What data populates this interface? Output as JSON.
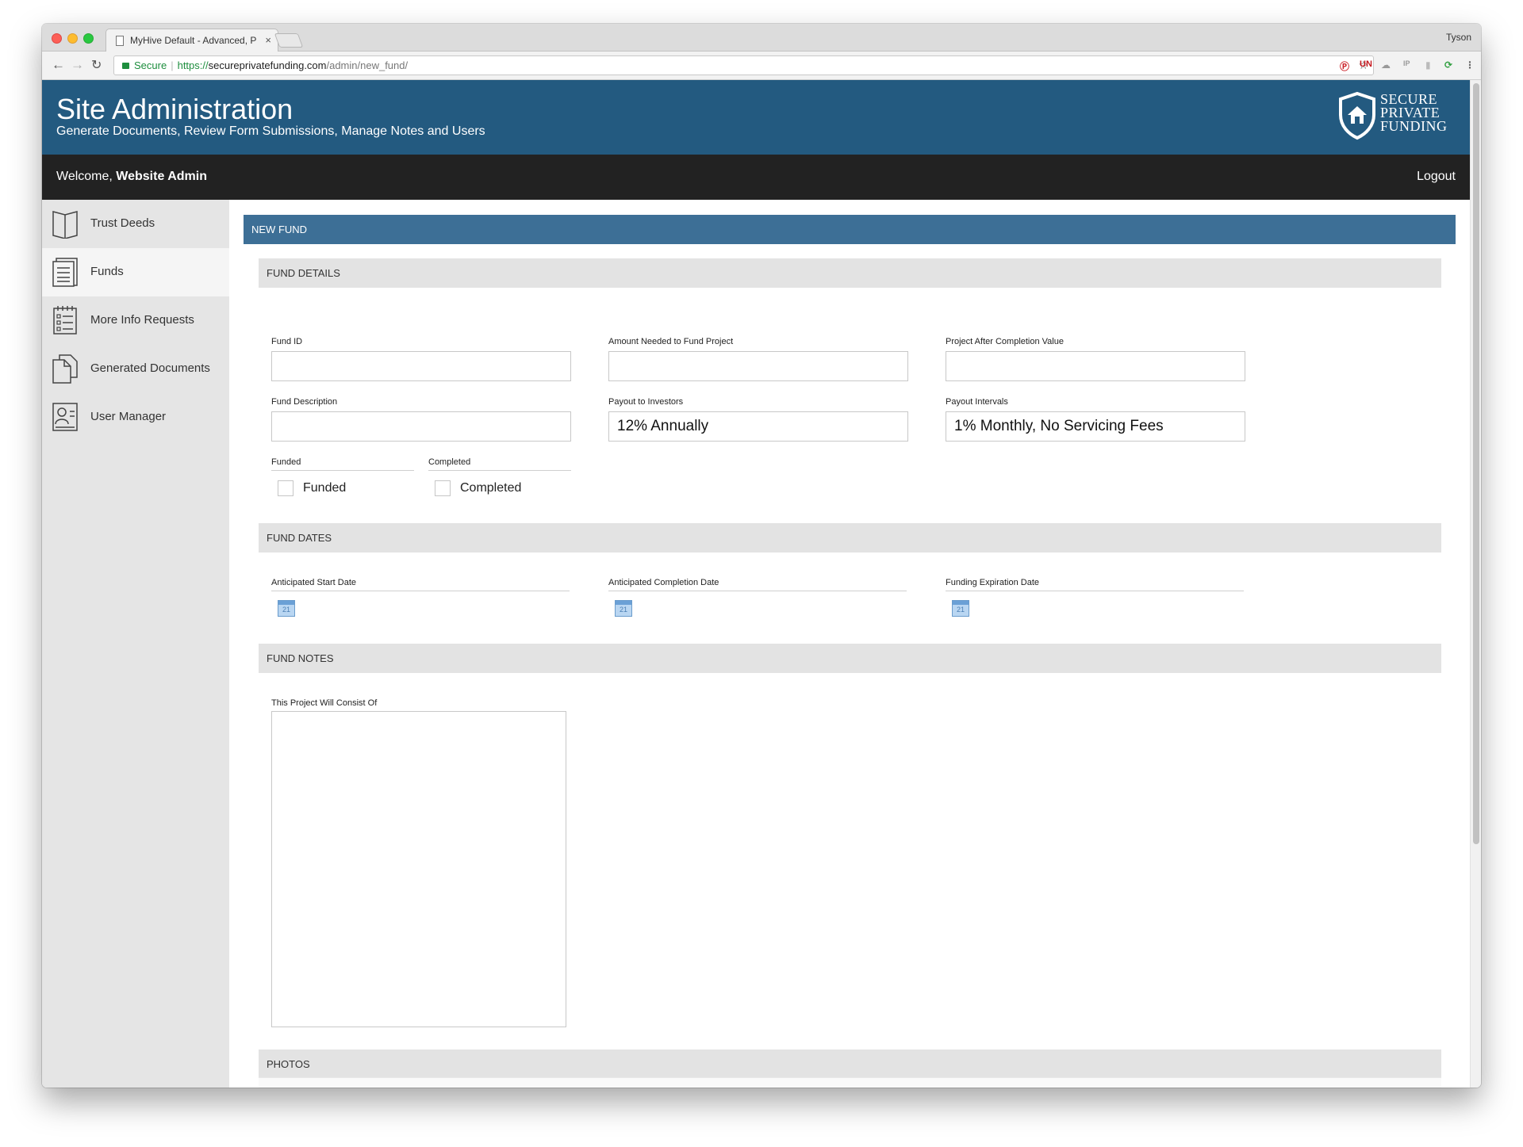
{
  "browser": {
    "tab_title": "MyHive Default - Advanced, P",
    "tab_close": "×",
    "profile": "Tyson",
    "secure_label": "Secure",
    "url_scheme": "https://",
    "url_host": "secureprivatefunding.com",
    "url_path": "/admin/new_fund/",
    "extensions": [
      "pinterest-icon",
      "un-icon",
      "cloud-icon",
      "ip-icon",
      "lock-ext-icon",
      "refresh-ext-icon"
    ]
  },
  "header": {
    "title": "Site Administration",
    "subtitle": "Generate Documents, Review Form Submissions, Manage Notes and Users",
    "logo_line1": "SECURE",
    "logo_line2": "PRIVATE",
    "logo_line3": "FUNDING"
  },
  "welcome_bar": {
    "welcome_prefix": "Welcome, ",
    "user_name": "Website Admin",
    "logout_label": "Logout"
  },
  "sidebar": {
    "items": [
      {
        "label": "Trust Deeds",
        "icon": "book-icon"
      },
      {
        "label": "Funds",
        "icon": "document-list-icon"
      },
      {
        "label": "More Info Requests",
        "icon": "checklist-icon"
      },
      {
        "label": "Generated Documents",
        "icon": "documents-icon"
      },
      {
        "label": "User Manager",
        "icon": "user-card-icon"
      }
    ],
    "active_index": 1
  },
  "panel": {
    "title": "NEW FUND"
  },
  "fund_details": {
    "section_title": "FUND DETAILS",
    "fund_id_label": "Fund ID",
    "fund_id_value": "",
    "amount_label": "Amount Needed to Fund Project",
    "amount_value": "",
    "completion_value_label": "Project After Completion Value",
    "completion_value_value": "",
    "description_label": "Fund Description",
    "description_value": "",
    "payout_label": "Payout to Investors",
    "payout_value": "12% Annually",
    "intervals_label": "Payout Intervals",
    "intervals_value": "1% Monthly, No Servicing Fees",
    "funded_group_label": "Funded",
    "funded_checkbox_label": "Funded",
    "completed_group_label": "Completed",
    "completed_checkbox_label": "Completed"
  },
  "fund_dates": {
    "section_title": "FUND DATES",
    "start_label": "Anticipated Start Date",
    "completion_label": "Anticipated Completion Date",
    "expiration_label": "Funding Expiration Date",
    "calendar_day": "21"
  },
  "fund_notes": {
    "section_title": "FUND NOTES",
    "consist_label": "This Project Will Consist Of",
    "consist_value": ""
  },
  "photos": {
    "section_title": "PHOTOS"
  }
}
